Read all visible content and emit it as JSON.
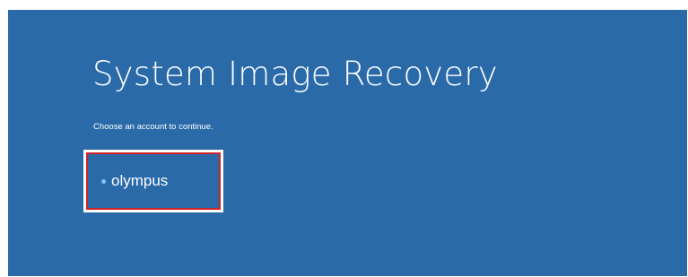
{
  "title": "System Image Recovery",
  "subtitle": "Choose an account to continue.",
  "accounts": [
    {
      "name": "olympus"
    }
  ]
}
